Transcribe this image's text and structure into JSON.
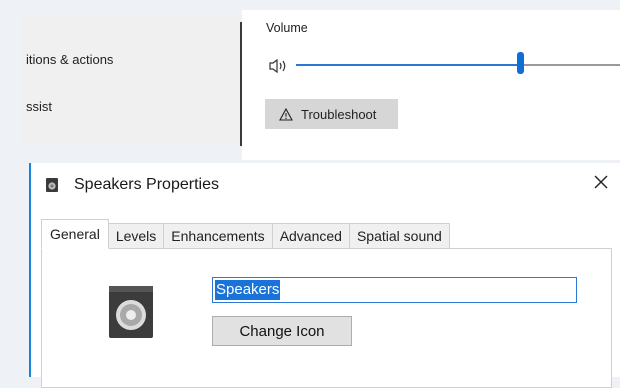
{
  "settings": {
    "nav_items": [
      {
        "label": "itions & actions"
      },
      {
        "label": "ssist"
      }
    ],
    "volume": {
      "label": "Volume",
      "level": 0.69
    },
    "troubleshoot_label": "Troubleshoot"
  },
  "dialog": {
    "title": "Speakers Properties",
    "tabs": [
      {
        "label": "General",
        "active": true
      },
      {
        "label": "Levels",
        "active": false
      },
      {
        "label": "Enhancements",
        "active": false
      },
      {
        "label": "Advanced",
        "active": false
      },
      {
        "label": "Spatial sound",
        "active": false
      }
    ],
    "device_name": "Speakers",
    "change_icon_label": "Change Icon"
  },
  "icons": {
    "speaker": "speaker-volume-icon",
    "warning": "warning-triangle-icon",
    "close": "close-icon",
    "device": "speaker-device-icon"
  },
  "colors": {
    "accent": "#1a73d9",
    "slider_fill": "#2b78d4"
  }
}
